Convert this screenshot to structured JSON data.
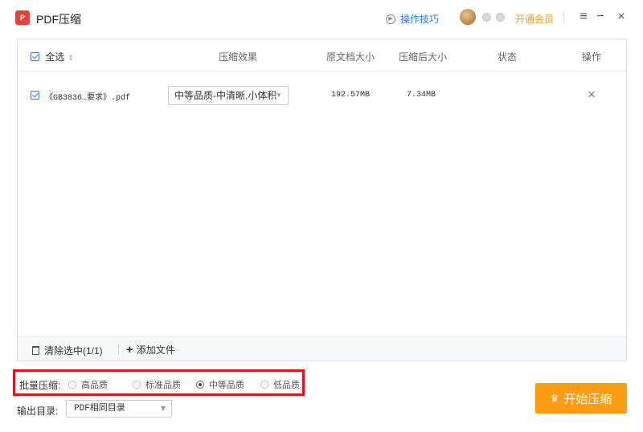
{
  "app": {
    "logo_text": "P",
    "title": "PDF压缩",
    "tips_label": "操作技巧",
    "vip_label": "开通会员",
    "menu_icon": "≡",
    "minimize_icon": "−",
    "close_icon": "×"
  },
  "table": {
    "headers": {
      "select_all": "全选",
      "effect": "压缩效果",
      "original_size": "原文档大小",
      "compressed_size": "压缩后大小",
      "status": "状态",
      "actions": "操作"
    },
    "rows": [
      {
        "checked": true,
        "file_name": "《GB3836…要求》.pdf",
        "quality": "中等品质-中清晰,小体积",
        "original_size": "192.57MB",
        "compressed_size": "7.34MB",
        "status": ""
      }
    ],
    "footer": {
      "clear_selected": "清除选中(1/1)",
      "add_file": "添加文件"
    }
  },
  "batch": {
    "label": "批量压缩:",
    "options": [
      "高品质",
      "标准品质",
      "中等品质",
      "低品质"
    ],
    "selected": "中等品质"
  },
  "output": {
    "label": "输出目录:",
    "value": "PDF相同目录"
  },
  "start_button": "开始压缩",
  "colors": {
    "accent_blue": "#3a7de0",
    "vip_orange": "#f29a1c",
    "start_button": "#ff9d12",
    "highlight_border": "#e0131c",
    "logo_red": "#e8413b"
  }
}
